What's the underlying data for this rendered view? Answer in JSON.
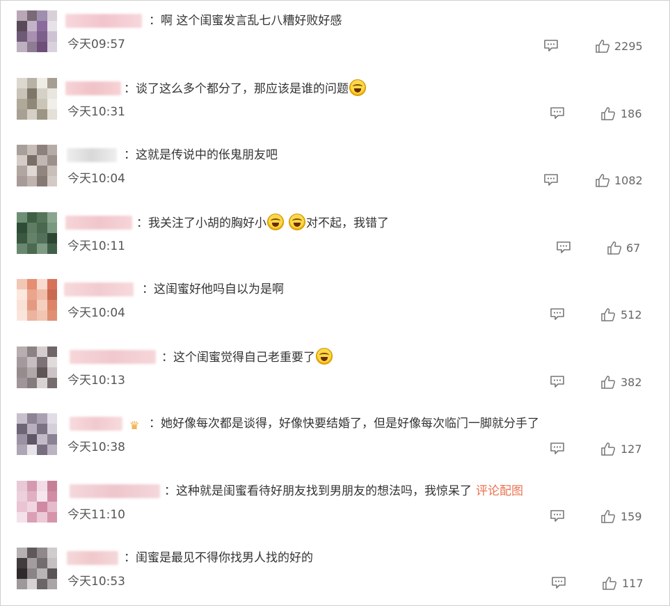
{
  "comments": [
    {
      "text": "：啊 这个闺蜜发言乱七八糟好败好感",
      "emoji_count": 0,
      "time": "今天09:57",
      "likes": "2295"
    },
    {
      "text": "：谈了这么多个都分了，那应该是谁的问题",
      "emoji_count": 1,
      "time": "今天10:31",
      "likes": "186"
    },
    {
      "text": "：这就是传说中的伥鬼朋友吧",
      "emoji_count": 0,
      "time": "今天10:04",
      "likes": "1082"
    },
    {
      "text": "：我关注了小胡的胸好小",
      "text_after": "对不起，我错了",
      "emoji_count": 2,
      "time": "今天10:11",
      "likes": "67"
    },
    {
      "text": "：这闺蜜好他吗自以为是啊",
      "emoji_count": 0,
      "time": "今天10:04",
      "likes": "512"
    },
    {
      "text": "：这个闺蜜觉得自己老重要了",
      "emoji_count": 1,
      "time": "今天10:13",
      "likes": "382"
    },
    {
      "text": "：她好像每次都是谈得，好像快要结婚了，但是好像每次临门一脚就分手了",
      "emoji_count": 0,
      "time": "今天10:38",
      "likes": "127",
      "crown": "♛"
    },
    {
      "text": "：这种就是闺蜜看待好朋友找到男朋友的想法吗，我惊呆了",
      "link": "评论配图",
      "emoji_count": 0,
      "time": "今天11:10",
      "likes": "159"
    },
    {
      "text": "：闺蜜是最见不得你找男人找的好的",
      "emoji_count": 0,
      "time": "今天10:53",
      "likes": "117"
    }
  ],
  "icons": {
    "reply": "comment-icon",
    "like": "thumbs-up-icon",
    "emoji": "laugh-cry-emoji"
  },
  "colors": {
    "link": "#eb7350",
    "text": "#333333",
    "meta": "#666666"
  }
}
